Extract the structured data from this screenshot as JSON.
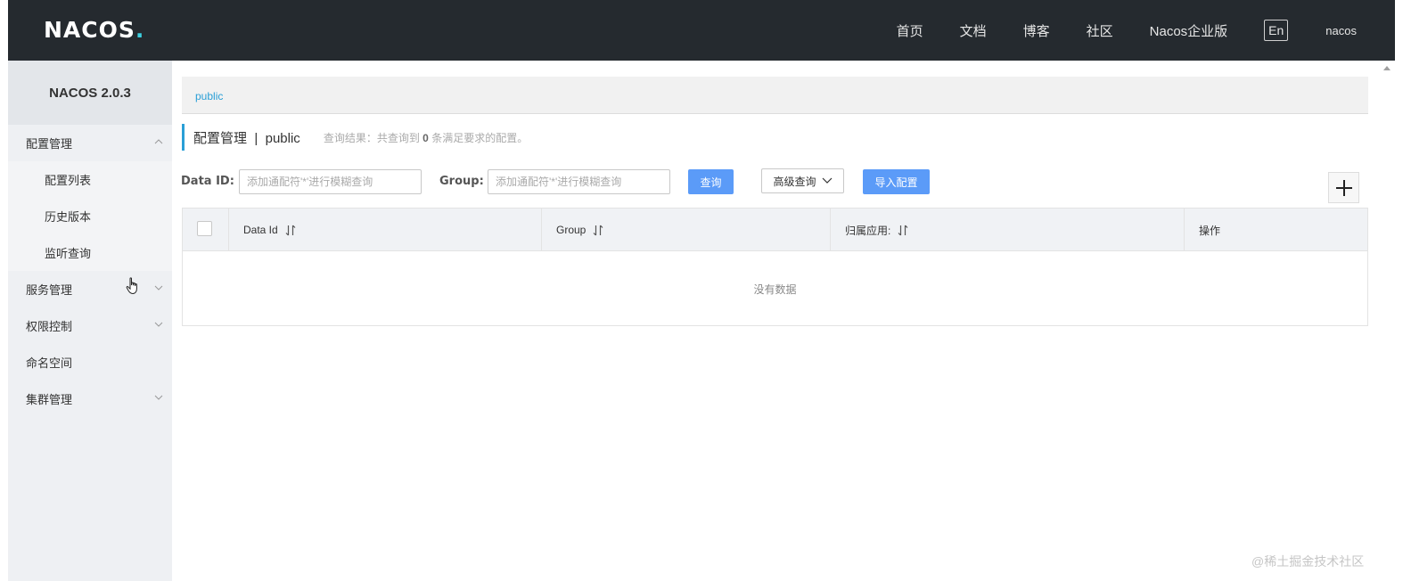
{
  "header": {
    "logo_text": "NACOS",
    "logo_dot": ".",
    "nav": [
      "首页",
      "文档",
      "博客",
      "社区",
      "Nacos企业版"
    ],
    "lang_button": "En",
    "user": "nacos"
  },
  "sidebar": {
    "title": "NACOS 2.0.3",
    "groups": [
      {
        "label": "配置管理",
        "expanded": true,
        "items": [
          "配置列表",
          "历史版本",
          "监听查询"
        ]
      },
      {
        "label": "服务管理",
        "expanded": false
      },
      {
        "label": "权限控制",
        "expanded": false
      },
      {
        "label": "命名空间"
      },
      {
        "label": "集群管理",
        "expanded": false
      }
    ]
  },
  "breadcrumb": {
    "namespace": "public"
  },
  "page": {
    "title": "配置管理",
    "separator": "|",
    "namespace": "public",
    "query_prefix": "查询结果：共查询到",
    "query_count": "0",
    "query_suffix": "条满足要求的配置。"
  },
  "filters": {
    "data_id_label": "Data ID:",
    "data_id_placeholder": "添加通配符'*'进行模糊查询",
    "group_label": "Group:",
    "group_placeholder": "添加通配符'*'进行模糊查询",
    "query_button": "查询",
    "advanced_button": "高级查询",
    "import_button": "导入配置"
  },
  "table": {
    "columns": [
      "Data Id",
      "Group",
      "归属应用:",
      "操作"
    ],
    "empty_text": "没有数据"
  },
  "colors": {
    "header_bg": "#252a2f",
    "accent": "#2a9fd6",
    "primary_button": "#5b9bf8",
    "sidebar_bg": "#eef0f3"
  },
  "watermark": "@稀土掘金技术社区"
}
